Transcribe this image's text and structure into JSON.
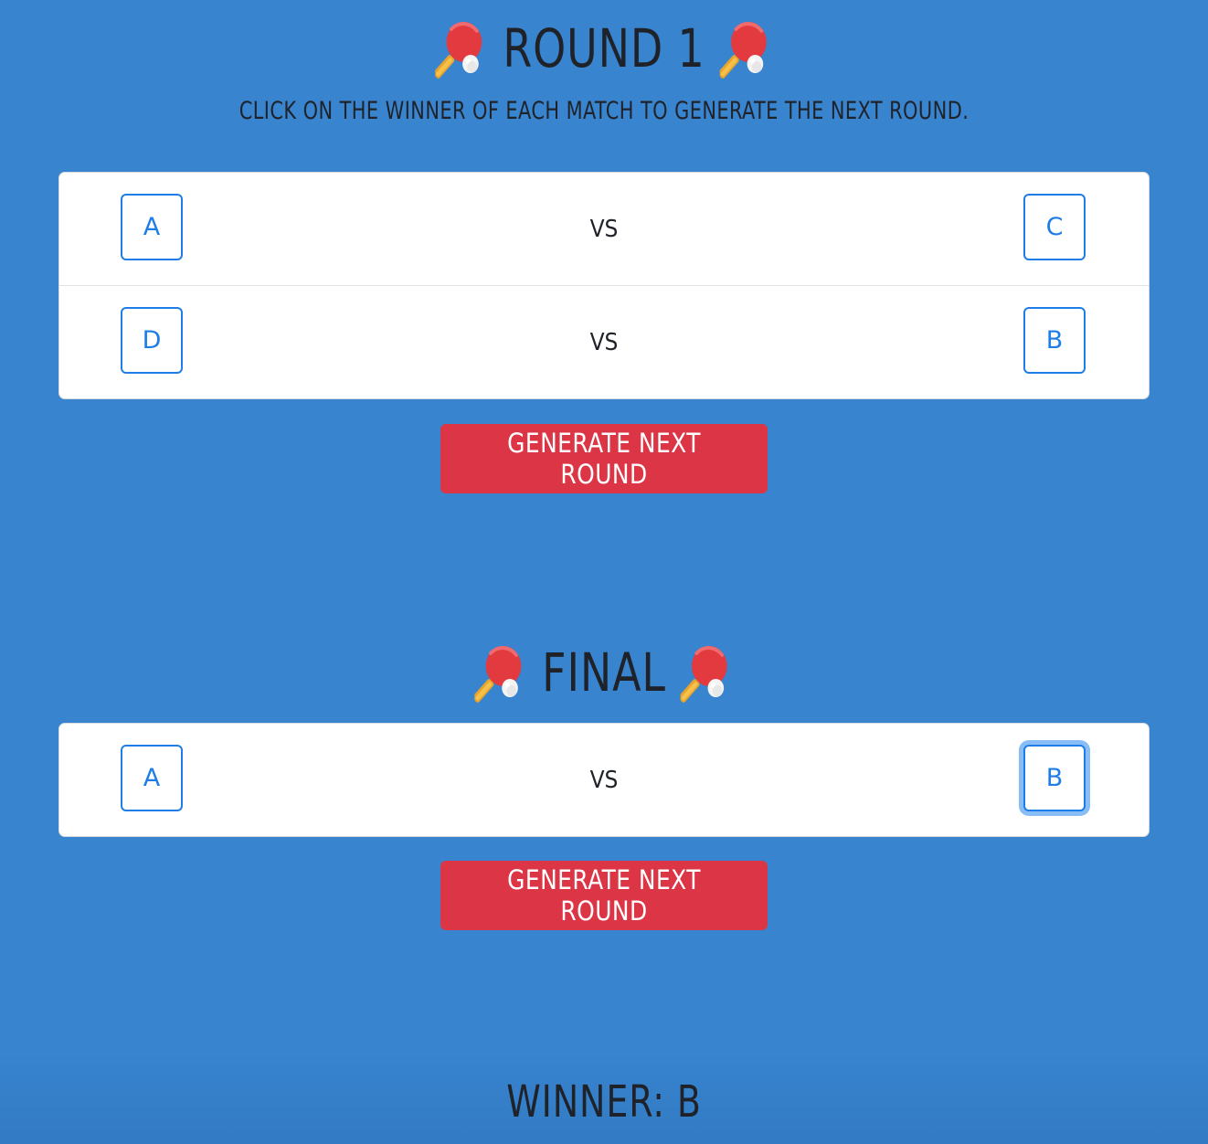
{
  "icons": {
    "round_title_icon": "ping-pong-paddle-icon"
  },
  "colors": {
    "background": "#3884cf",
    "player_button_border": "#1e7de6",
    "generate_button": "#dc3545",
    "text_dark": "#1f2329"
  },
  "round1": {
    "title": "ROUND 1",
    "instruction": "CLICK ON THE WINNER OF EACH MATCH TO GENERATE THE NEXT ROUND.",
    "matches": [
      {
        "left": "A",
        "vs": "VS",
        "right": "C"
      },
      {
        "left": "D",
        "vs": "VS",
        "right": "B"
      }
    ],
    "generate_label": "GENERATE NEXT ROUND"
  },
  "final": {
    "title": "FINAL",
    "matches": [
      {
        "left": "A",
        "vs": "VS",
        "right": "B"
      }
    ],
    "generate_label": "GENERATE NEXT ROUND"
  },
  "winner": {
    "text": "WINNER: B"
  }
}
